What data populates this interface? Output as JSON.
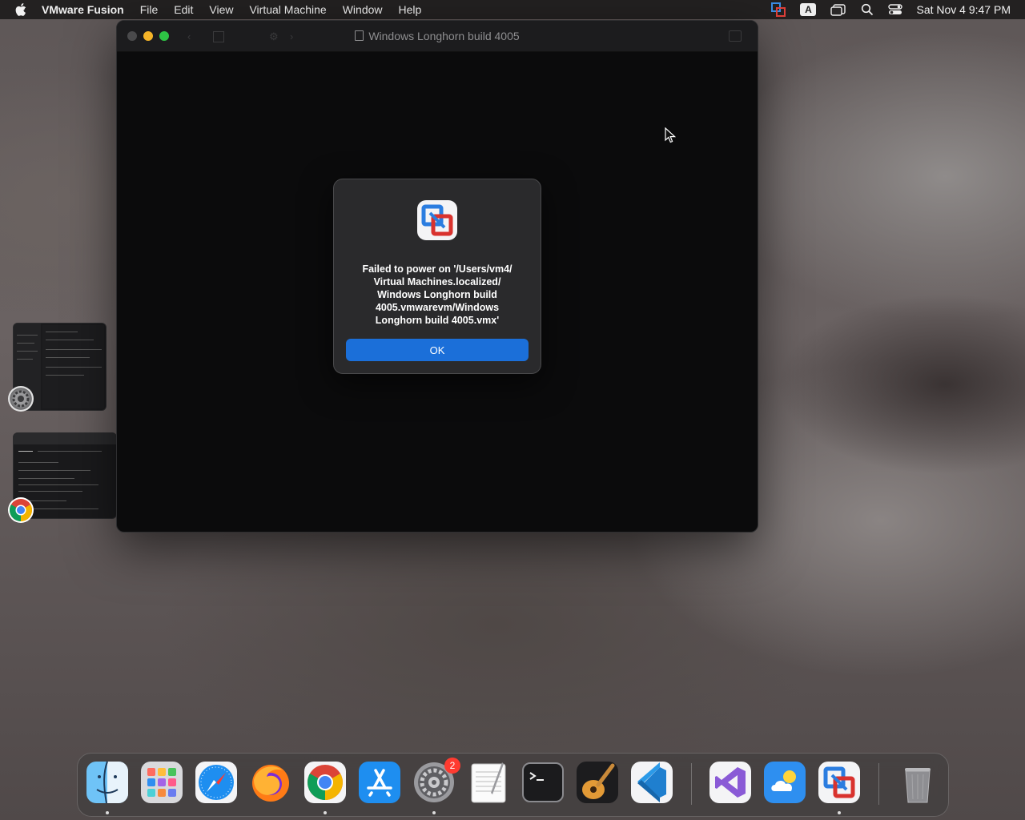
{
  "menubar": {
    "app_name": "VMware Fusion",
    "items": [
      "File",
      "Edit",
      "View",
      "Virtual Machine",
      "Window",
      "Help"
    ],
    "status_icons": [
      "vmware-fusion-icon",
      "input-source-icon",
      "window-icon",
      "search-icon",
      "control-center-icon"
    ],
    "input_source": "A",
    "clock": "Sat Nov 4  9:47 PM"
  },
  "vm_window": {
    "title": "Windows Longhorn build 4005"
  },
  "dialog": {
    "message": "Failed to power on '/Users/vm4/ Virtual Machines.localized/ Windows Longhorn build 4005.vmwarevm/Windows Longhorn build 4005.vmx'",
    "ok_label": "OK"
  },
  "thumbnails": [
    {
      "app": "System Settings",
      "icon": "system-settings-icon"
    },
    {
      "app": "Google Chrome",
      "icon": "chrome-icon"
    }
  ],
  "dock": {
    "items": [
      {
        "name": "Finder",
        "icon": "finder-icon",
        "running": true
      },
      {
        "name": "Launchpad",
        "icon": "launchpad-icon",
        "running": false
      },
      {
        "name": "Safari",
        "icon": "safari-icon",
        "running": false
      },
      {
        "name": "Firefox",
        "icon": "firefox-icon",
        "running": false
      },
      {
        "name": "Google Chrome",
        "icon": "chrome-icon",
        "running": true
      },
      {
        "name": "App Store",
        "icon": "app-store-icon",
        "running": false
      },
      {
        "name": "System Settings",
        "icon": "system-settings-icon",
        "running": true,
        "badge": "2"
      },
      {
        "name": "TextEdit",
        "icon": "textedit-icon",
        "running": false
      },
      {
        "name": "Terminal",
        "icon": "terminal-icon",
        "running": false
      },
      {
        "name": "GarageBand",
        "icon": "garageband-icon",
        "running": false
      },
      {
        "name": "Visual Studio Code",
        "icon": "vscode-icon",
        "running": false
      },
      {
        "name": "Visual Studio",
        "icon": "visual-studio-icon",
        "running": false
      },
      {
        "name": "Weather",
        "icon": "weather-icon",
        "running": false
      },
      {
        "name": "VMware Fusion",
        "icon": "vmware-fusion-icon",
        "running": true
      },
      {
        "name": "Trash",
        "icon": "trash-icon",
        "running": false
      }
    ]
  },
  "colors": {
    "accent": "#1b6fd9",
    "badge": "#ff3b30",
    "traffic_minimize": "#f5b428",
    "traffic_zoom": "#2ec445"
  }
}
